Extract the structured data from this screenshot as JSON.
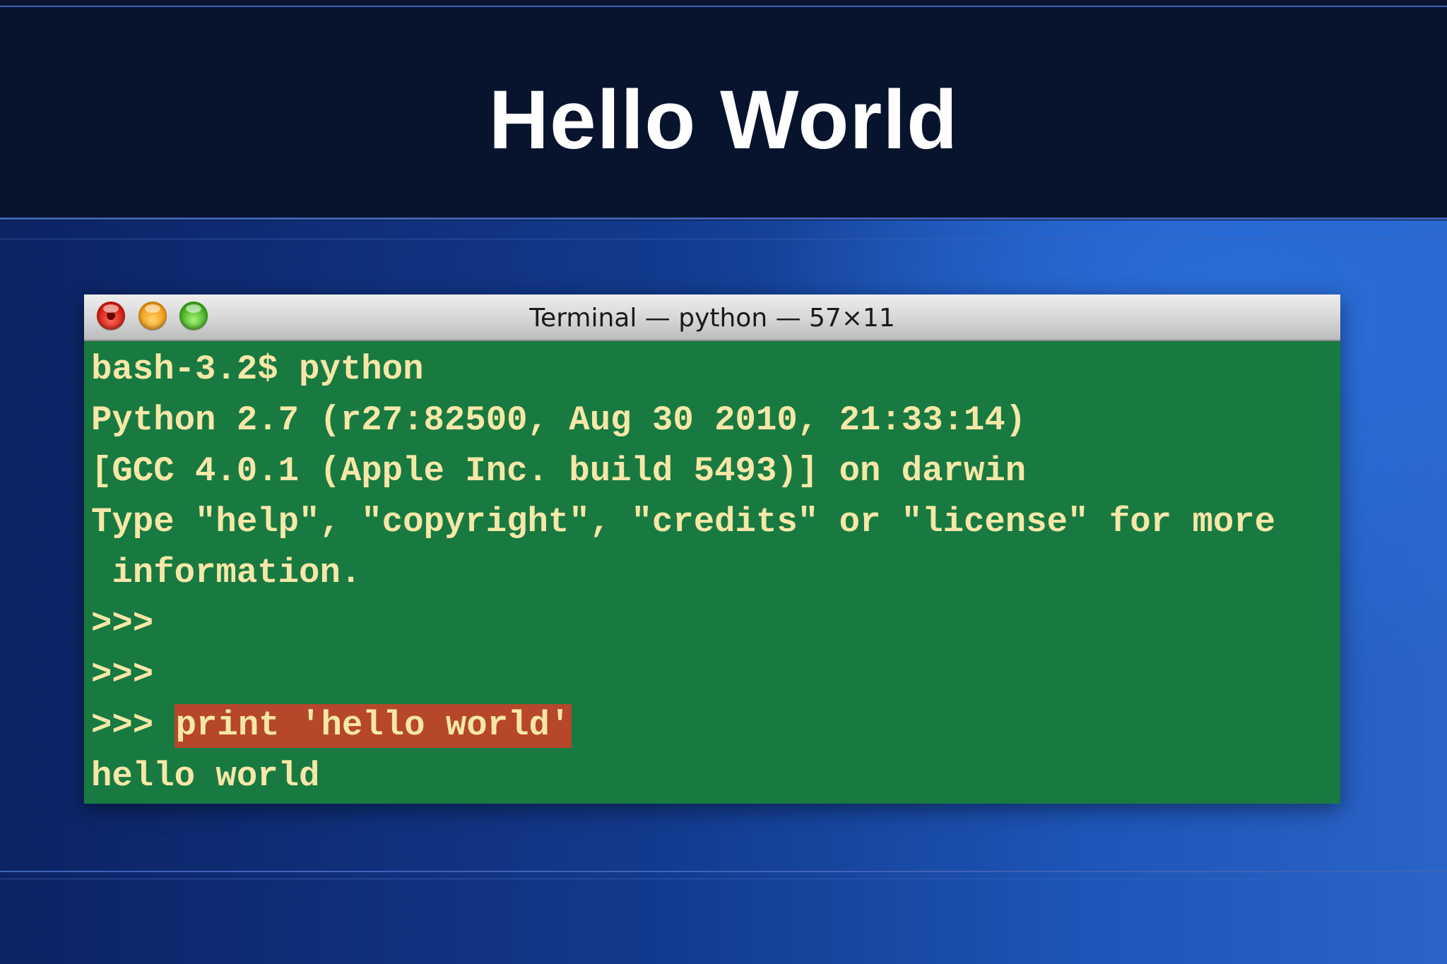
{
  "slide": {
    "title": "Hello World"
  },
  "terminal": {
    "window_title": "Terminal — python — 57×11",
    "buttons": [
      "close",
      "minimize",
      "zoom"
    ],
    "lines": [
      "bash-3.2$ python",
      "Python 2.7 (r27:82500, Aug 30 2010, 21:33:14)",
      "[GCC 4.0.1 (Apple Inc. build 5493)] on darwin",
      "Type \"help\", \"copyright\", \"credits\" or \"license\" for more",
      " information.",
      ">>>",
      ">>>"
    ],
    "command_prompt": ">>> ",
    "command_highlighted": "print 'hello world'",
    "output": "hello world"
  },
  "colors": {
    "terminal_background": "#187a40",
    "terminal_text": "#f6e7a8",
    "selection_highlight": "#b6472a",
    "title_band": "#08142e",
    "slide_title": "#ffffff"
  }
}
